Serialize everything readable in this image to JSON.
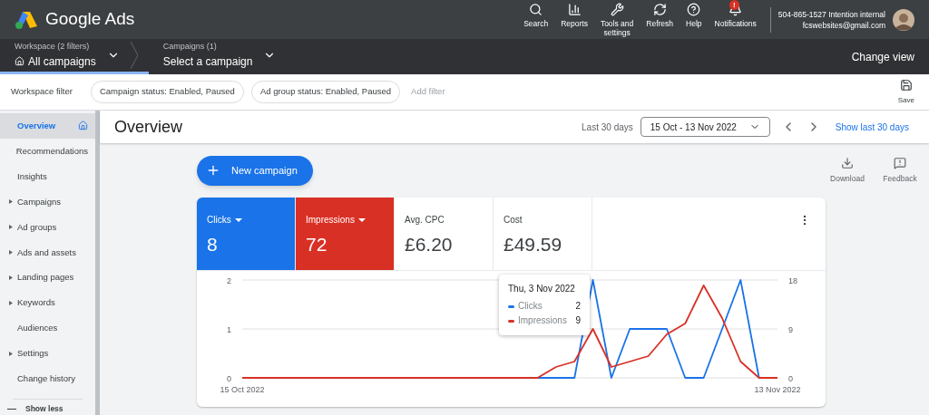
{
  "header": {
    "product": "Google Ads",
    "tools": [
      {
        "kind": "search",
        "label": "Search"
      },
      {
        "kind": "reports",
        "label": "Reports"
      },
      {
        "kind": "tools",
        "label": "Tools and\nsettings"
      },
      {
        "kind": "refresh",
        "label": "Refresh"
      },
      {
        "kind": "help",
        "label": "Help"
      },
      {
        "kind": "bell",
        "label": "Notifications",
        "badge": "!"
      }
    ],
    "account": {
      "name": "504-865-1527 Intention internal",
      "email": "fcswebsites@gmail.com"
    }
  },
  "breadcrumbs": [
    {
      "caption": "Workspace (2 filters)",
      "value": "All campaigns",
      "home": true,
      "selected": true
    },
    {
      "caption": "Campaigns (1)",
      "value": "Select a campaign",
      "home": false,
      "selected": false
    }
  ],
  "change_view": "Change view",
  "filter_bar": {
    "label": "Workspace filter",
    "chips": [
      "Campaign status: Enabled, Paused",
      "Ad group status: Enabled, Paused"
    ],
    "add_filter": "Add filter",
    "save": "Save"
  },
  "sidebar": {
    "items": [
      {
        "label": "Overview",
        "expandable": false,
        "selected": true
      },
      {
        "label": "Recommendations",
        "expandable": false,
        "selected": false
      },
      {
        "label": "Insights",
        "expandable": false,
        "selected": false
      },
      {
        "label": "Campaigns",
        "expandable": true,
        "selected": false
      },
      {
        "label": "Ad groups",
        "expandable": true,
        "selected": false
      },
      {
        "label": "Ads and assets",
        "expandable": true,
        "selected": false
      },
      {
        "label": "Landing pages",
        "expandable": true,
        "selected": false
      },
      {
        "label": "Keywords",
        "expandable": true,
        "selected": false
      },
      {
        "label": "Audiences",
        "expandable": false,
        "selected": false
      },
      {
        "label": "Settings",
        "expandable": true,
        "selected": false
      },
      {
        "label": "Change history",
        "expandable": false,
        "selected": false
      }
    ],
    "show_less": "Show less"
  },
  "page": {
    "title": "Overview",
    "range_label": "Last 30 days",
    "date_range": "15 Oct - 13 Nov 2022",
    "show_last": "Show last 30 days"
  },
  "new_campaign": "New campaign",
  "actions": [
    {
      "kind": "download",
      "label": "Download"
    },
    {
      "kind": "feedback",
      "label": "Feedback"
    }
  ],
  "metrics": [
    {
      "label": "Clicks",
      "value": "8",
      "selected": true,
      "color": "#1a73e8",
      "dropdown": true
    },
    {
      "label": "Impressions",
      "value": "72",
      "selected": true,
      "color": "#d93025",
      "dropdown": true
    },
    {
      "label": "Avg. CPC",
      "value": "£6.20",
      "selected": false,
      "dropdown": false
    },
    {
      "label": "Cost",
      "value": "£49.59",
      "selected": false,
      "dropdown": false
    }
  ],
  "chart": {
    "left_axis": {
      "chart_data": {
        "type": "line",
        "categories": [
          "15 Oct 2022",
          null,
          null,
          null,
          null,
          null,
          null,
          null,
          null,
          null,
          null,
          null,
          null,
          null,
          null,
          null,
          null,
          null,
          null,
          null,
          null,
          null,
          null,
          null,
          null,
          null,
          null,
          null,
          null,
          "13 Nov 2022"
        ],
        "yticks": [
          0,
          1,
          2
        ],
        "ylim": [
          0,
          2
        ],
        "series": [
          {
            "color": "#1a73e8",
            "values": [
              null,
              null,
              null,
              null,
              null,
              null,
              null,
              null,
              null,
              null,
              null,
              null,
              null,
              null,
              null,
              null,
              0,
              0,
              0,
              2,
              0,
              1,
              1,
              1,
              0,
              0,
              1,
              2,
              0,
              0
            ]
          }
        ]
      }
    },
    "right_axis": {
      "chart_data": {
        "type": "line",
        "yticks": [
          0,
          9,
          18
        ],
        "ylim": [
          0,
          18
        ],
        "series": [
          {
            "color": "#d93025",
            "values": [
              0,
              0,
              0,
              0,
              0,
              0,
              0,
              0,
              0,
              0,
              0,
              0,
              0,
              0,
              0,
              0,
              0,
              2,
              3,
              9,
              2,
              3,
              4,
              8,
              10,
              17,
              11,
              3,
              0,
              0
            ]
          }
        ]
      }
    },
    "tooltip": {
      "title": "Thu, 3 Nov 2022",
      "rows": [
        {
          "name": "Clicks",
          "value": "2",
          "color": "#1a73e8"
        },
        {
          "name": "Impressions",
          "value": "9",
          "color": "#d93025"
        }
      ]
    }
  }
}
